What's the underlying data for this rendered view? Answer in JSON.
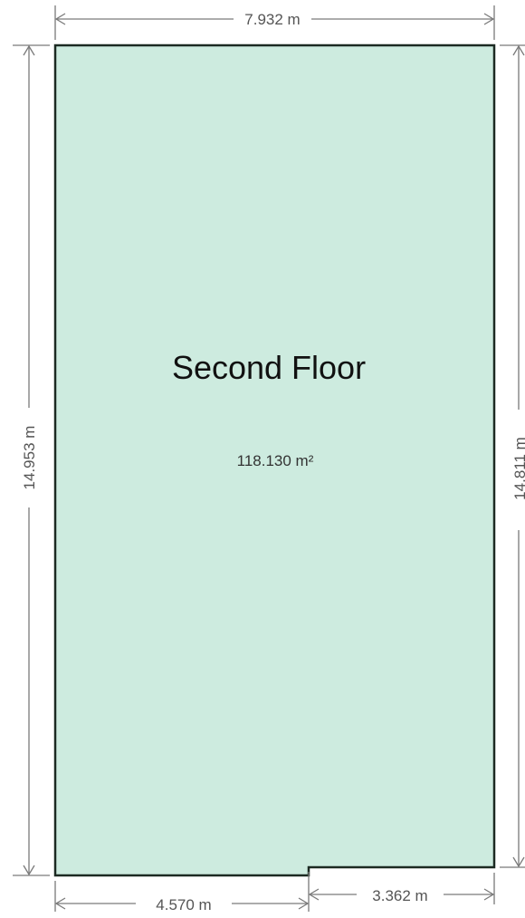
{
  "room": {
    "name": "Second Floor",
    "area": "118.130 m²",
    "fill_color": "#cdebdf",
    "outline_color": "#1c2a22"
  },
  "dimensions": {
    "top_width": "7.932 m",
    "left_height": "14.953 m",
    "right_height": "14.811 m",
    "bottom_left_width": "4.570 m",
    "bottom_right_width": "3.362 m"
  },
  "colors": {
    "dimension_line": "#7a7a7a",
    "dimension_text": "#555555"
  }
}
